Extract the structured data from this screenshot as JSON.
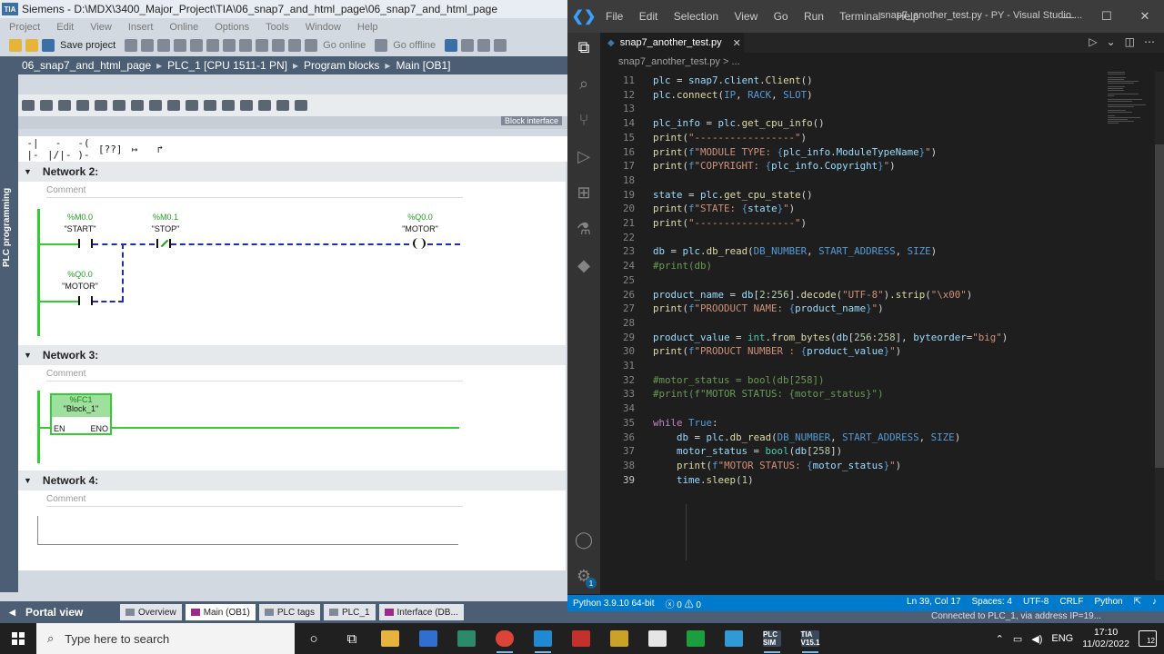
{
  "tia": {
    "title": "Siemens  -  D:\\MDX\\3400_Major_Project\\TIA\\06_snap7_and_html_page\\06_snap7_and_html_page",
    "menu": [
      "Project",
      "Edit",
      "View",
      "Insert",
      "Online",
      "Options",
      "Tools",
      "Window",
      "Help"
    ],
    "toolbar": {
      "save": "Save project",
      "go_online": "Go online",
      "go_offline": "Go offline"
    },
    "breadcrumb": [
      "06_snap7_and_html_page",
      "PLC_1 [CPU 1511-1 PN]",
      "Program blocks",
      "Main [OB1]"
    ],
    "left_strip_label": "PLC programming",
    "block_interface_label": "Block interface",
    "networks": [
      {
        "label": "Network 2:",
        "comment": "Comment"
      },
      {
        "label": "Network 3:",
        "comment": "Comment"
      },
      {
        "label": "Network 4:",
        "comment": "Comment"
      }
    ],
    "n2": {
      "start_addr": "%M0.0",
      "start_sym": "\"START\"",
      "stop_addr": "%M0.1",
      "stop_sym": "\"STOP\"",
      "motor_addr": "%Q0.0",
      "motor_sym": "\"MOTOR\"",
      "hold_addr": "%Q0.0",
      "hold_sym": "\"MOTOR\""
    },
    "n3": {
      "fc_addr": "%FC1",
      "fc_name": "\"Block_1\"",
      "en": "EN",
      "eno": "ENO"
    },
    "bottom": {
      "portal": "Portal view",
      "tabs": [
        "Overview",
        "Main (OB1)",
        "PLC tags",
        "PLC_1",
        "Interface (DB..."
      ]
    }
  },
  "vscode": {
    "menu": [
      "File",
      "Edit",
      "Selection",
      "View",
      "Go",
      "Run",
      "Terminal",
      "Help"
    ],
    "window_title": "snap7_another_test.py - PY - Visual Studio ...",
    "tab": "snap7_another_test.py",
    "breadcrumb": "snap7_another_test.py > ...",
    "code": [
      {
        "n": "11",
        "t": "plc = snap7.client.Client()"
      },
      {
        "n": "12",
        "t": "plc.connect(IP, RACK, SLOT)"
      },
      {
        "n": "13",
        "t": ""
      },
      {
        "n": "14",
        "t": "plc_info = plc.get_cpu_info()"
      },
      {
        "n": "15",
        "t": "print(\"-----------------\")"
      },
      {
        "n": "16",
        "t": "print(f\"MODULE TYPE: {plc_info.ModuleTypeName}\")"
      },
      {
        "n": "17",
        "t": "print(f\"COPYRIGHT: {plc_info.Copyright}\")"
      },
      {
        "n": "18",
        "t": ""
      },
      {
        "n": "19",
        "t": "state = plc.get_cpu_state()"
      },
      {
        "n": "20",
        "t": "print(f\"STATE: {state}\")"
      },
      {
        "n": "21",
        "t": "print(\"-----------------\")"
      },
      {
        "n": "22",
        "t": ""
      },
      {
        "n": "23",
        "t": "db = plc.db_read(DB_NUMBER, START_ADDRESS, SIZE)"
      },
      {
        "n": "24",
        "t": "#print(db)"
      },
      {
        "n": "25",
        "t": ""
      },
      {
        "n": "26",
        "t": "product_name = db[2:256].decode(\"UTF-8\").strip(\"\\x00\")"
      },
      {
        "n": "27",
        "t": "print(f\"PROODUCT NAME: {product_name}\")"
      },
      {
        "n": "28",
        "t": ""
      },
      {
        "n": "29",
        "t": "product_value = int.from_bytes(db[256:258], byteorder=\"big\")"
      },
      {
        "n": "30",
        "t": "print(f\"PRODUCT NUMBER : {product_value}\")"
      },
      {
        "n": "31",
        "t": ""
      },
      {
        "n": "32",
        "t": "#motor_status = bool(db[258])"
      },
      {
        "n": "33",
        "t": "#print(f\"MOTOR STATUS: {motor_status}\")"
      },
      {
        "n": "34",
        "t": ""
      },
      {
        "n": "35",
        "t": "while True:"
      },
      {
        "n": "36",
        "t": "    db = plc.db_read(DB_NUMBER, START_ADDRESS, SIZE)"
      },
      {
        "n": "37",
        "t": "    motor_status = bool(db[258])"
      },
      {
        "n": "38",
        "t": "    print(f\"MOTOR STATUS: {motor_status}\")"
      },
      {
        "n": "39",
        "t": "    time.sleep(1)"
      }
    ],
    "status": {
      "python": "Python 3.9.10 64-bit",
      "problems": "ⓧ 0 ⚠ 0",
      "position": "Ln 39, Col 17",
      "spaces": "Spaces: 4",
      "encoding": "UTF-8",
      "eol": "CRLF",
      "language": "Python"
    },
    "bottom_peek": "Connected to PLC_1, via address IP=19..."
  },
  "taskbar": {
    "search_placeholder": "Type here to search",
    "tray_lang": "ENG",
    "time": "17:10",
    "date": "11/02/2022",
    "notifications": "12",
    "app_labels": [
      "PLC SIM",
      "TIA V15.1"
    ]
  }
}
